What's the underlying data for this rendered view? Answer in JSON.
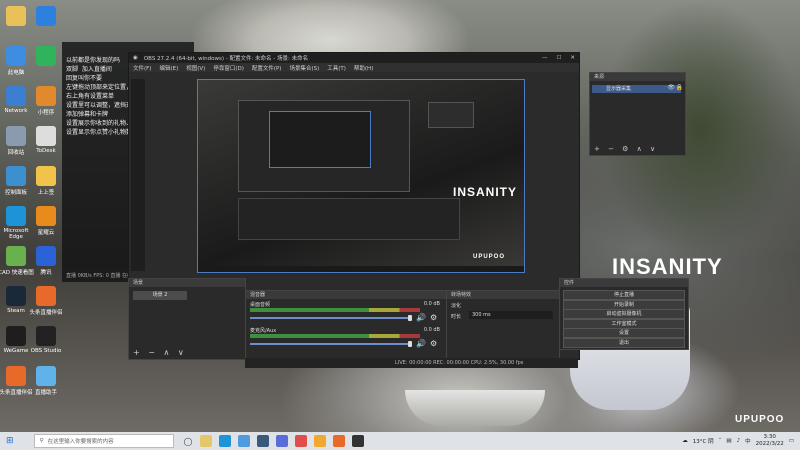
{
  "desktop_icons": [
    {
      "label": "",
      "color": "#e8c158",
      "icon": "folder-icon"
    },
    {
      "label": "此电脑",
      "color": "#3d8de0",
      "icon": "computer-icon"
    },
    {
      "label": "Network",
      "color": "#3a7fd1",
      "icon": "network-icon"
    },
    {
      "label": "回收站",
      "color": "#8a9bb0",
      "icon": "recycle-bin-icon"
    },
    {
      "label": "控制面板",
      "color": "#3e8fcf",
      "icon": "control-panel-icon"
    },
    {
      "label": "Microsoft Edge",
      "color": "#1d93d8",
      "icon": "edge-icon"
    },
    {
      "label": "CAD 快速看图",
      "color": "#6ab04c",
      "icon": "cad-icon"
    },
    {
      "label": "Steam",
      "color": "#1b2838",
      "icon": "steam-icon"
    },
    {
      "label": "WeGame",
      "color": "#1e1e1e",
      "icon": "wegame-icon"
    },
    {
      "label": "头条直播伴侣",
      "color": "#e86a2a",
      "icon": "live-icon"
    }
  ],
  "desktop_icons_col2": [
    {
      "label": "",
      "color": "#2d7fe0",
      "icon": "app-icon"
    },
    {
      "label": "",
      "color": "#2fb35b",
      "icon": "wechat-icon"
    },
    {
      "label": "小程序",
      "color": "#e08a2d",
      "icon": "app-icon"
    },
    {
      "label": "ToDesk",
      "color": "#ddd",
      "icon": "todesk-icon"
    },
    {
      "label": "上上签",
      "color": "#f2c34a",
      "icon": "app-icon"
    },
    {
      "label": "星耀云",
      "color": "#e98a1d",
      "icon": "app-icon"
    },
    {
      "label": "腾讯",
      "color": "#2b62d6",
      "icon": "app-icon"
    },
    {
      "label": "头条直播伴侣",
      "color": "#e86a2a",
      "icon": "live-icon"
    },
    {
      "label": "OBS Studio",
      "color": "#222",
      "icon": "obs-icon"
    },
    {
      "label": "直播助手",
      "color": "#5fb3e8",
      "icon": "app-icon"
    }
  ],
  "chat": {
    "lines": [
      "以前都是你发现的吗",
      "双脚 ​ 加入直播间",
      "",
      "回复叫你不要",
      "左键拖动顶部来定位置，左键拉动边框改变大小",
      "",
      "右上角有设置菜单",
      "设置里可以调整，遮挡开播/隐藏，和反馈升级",
      "添加弹幕和卡牌",
      "",
      "设置展示你收到的礼物、道具",
      "设置显示你点赞小礼物数量"
    ],
    "footer": "直播 0KB/s  FPS: 0   直播  在线"
  },
  "obs": {
    "title": "OBS 27.2.4 (64-bit, windows) - 配置文件: 未命名 - 场景: 未命名",
    "menu": [
      "文件(F)",
      "编辑(E)",
      "视图(V)",
      "停靠窗口(D)",
      "配置文件(P)",
      "场景集合(S)",
      "工具(T)",
      "帮助(H)"
    ],
    "scene_item": "场景 2",
    "mixer_title": "混音器",
    "mixer_tracks": [
      {
        "label": "桌面音频",
        "db": "0.0 dB"
      },
      {
        "label": "麦克风/Aux",
        "db": "0.0 dB"
      }
    ],
    "transition_title": "转场特效",
    "transition_name": "淡化",
    "duration_label": "时长",
    "duration_value": "300 ms",
    "controls_title": "控件",
    "controls": [
      "停止直播",
      "开始录制",
      "启动虚拟摄像机",
      "工作室模式",
      "设置",
      "退出"
    ],
    "status": "LIVE: 00:00:00   REC: 00:00:00   CPU: 2.5%, 30.00 fps",
    "sources_title": "来源",
    "source_item": "显示器采集"
  },
  "watermark": {
    "insanity": "INSANITY",
    "brand": "UPUPOO"
  },
  "taskbar": {
    "search_placeholder": "在这里输入你要搜索的内容",
    "weather": "13°C 阴",
    "time": "3:30",
    "date": "2022/3/22",
    "ime": "中"
  }
}
